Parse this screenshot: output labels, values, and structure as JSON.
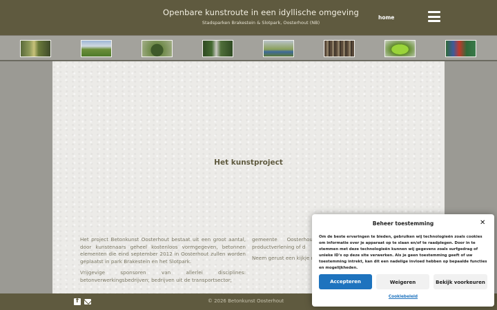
{
  "header": {
    "title": "Openbare kunstroute in een idyllische omgeving",
    "subtitle": "Stadsparken Brakestein & Slotpark, Oosterhout (NB)",
    "nav_home": "home",
    "menu_icon": "hamburger-menu-icon",
    "background": "#5f5a3f"
  },
  "gallery": {
    "thumbnails": [
      {
        "name": "thumb-1"
      },
      {
        "name": "thumb-2"
      },
      {
        "name": "thumb-3"
      },
      {
        "name": "thumb-4"
      },
      {
        "name": "thumb-5"
      },
      {
        "name": "thumb-6"
      },
      {
        "name": "thumb-7"
      },
      {
        "name": "thumb-8"
      }
    ]
  },
  "main": {
    "section_title": "Het kunstproject",
    "left_column": {
      "p1": "Het project Betonkunst Oosterhout bestaat uit een groot aantal, door kunstenaars geheel kostenloos vormgegeven, betonnen elementen die eind september 2012 in Oosterhout zullen worden geplaatst in park Brakestein en het Slotpark.",
      "p2": "Vrijgevige sponsoren van allerlei disciplines: betonverwerkingsbedrijven; bedrijven uit de transportsector;"
    },
    "right_column": {
      "p1": "gemeente Oosterhout; particulieren, maakten h of productverlening of d",
      "p2": "Neem gerust een kijkje met hen te maken! Med kunstparken bij!"
    }
  },
  "footer": {
    "copyright": "© 2026 Betonkunst Oosterhout",
    "icons": [
      "facebook-icon",
      "mail-icon"
    ]
  },
  "cookie_dialog": {
    "title": "Beheer toestemming",
    "close_icon": "close-icon",
    "text": "Om de beste ervaringen te bieden, gebruiken wij technologieën zoals cookies om informatie over je apparaat op te slaan en/of te raadplegen. Door in te stemmen met deze technologieën kunnen wij gegevens zoals surfgedrag of unieke ID's op deze site verwerken. Als je geen toestemming geeft of uw toestemming intrekt, kan dit een nadelige invloed hebben op bepaalde functies en mogelijkheden.",
    "accept_label": "Accepteren",
    "reject_label": "Weigeren",
    "preferences_label": "Bekijk voorkeuren",
    "policy_link": "Cookiebeleid",
    "accent": "#1e73be"
  }
}
